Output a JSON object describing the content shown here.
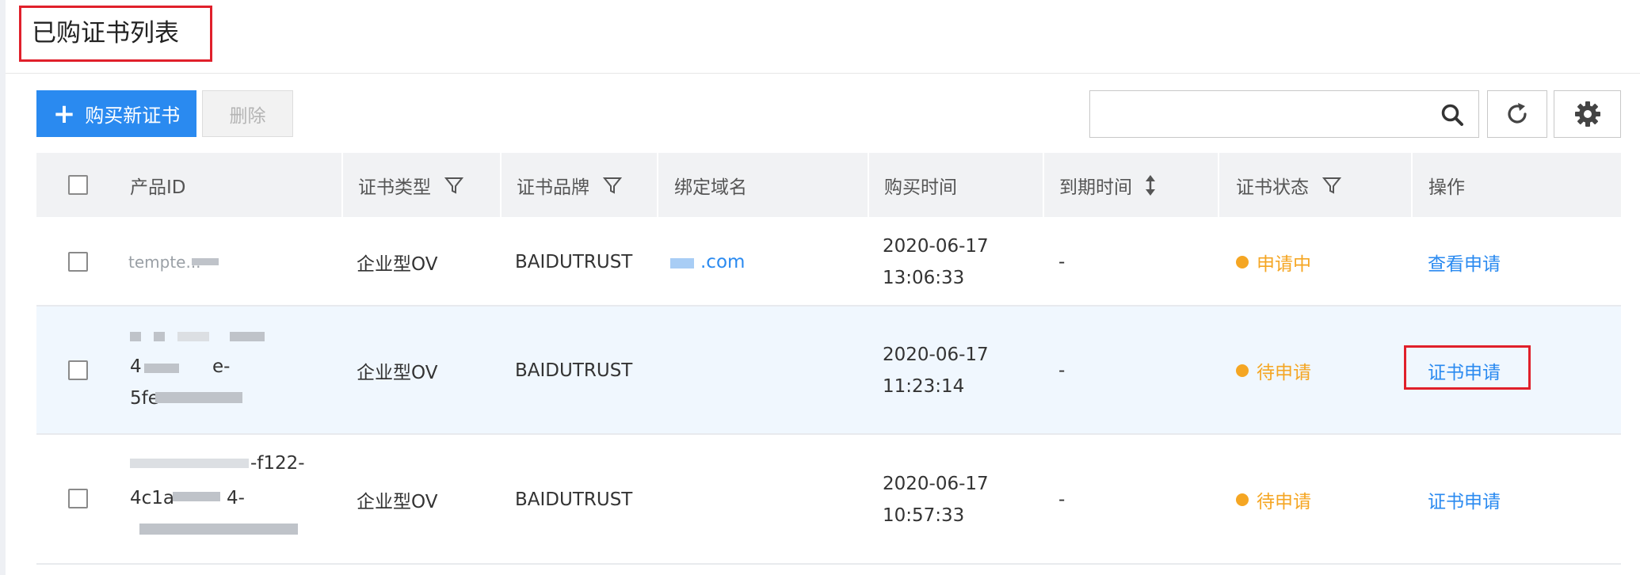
{
  "page": {
    "title": "已购证书列表"
  },
  "toolbar": {
    "buy_button_label": "购买新证书",
    "delete_button_label": "删除",
    "search_placeholder": ""
  },
  "table": {
    "columns": [
      "产品ID",
      "证书类型",
      "证书品牌",
      "绑定域名",
      "购买时间",
      "到期时间",
      "证书状态",
      "操作"
    ],
    "rows": [
      {
        "product_id": "tempte...",
        "cert_type": "企业型OV",
        "brand": "BAIDUTRUST",
        "domain": ".com",
        "purchase_date": "2020-06-17",
        "purchase_time": "13:06:33",
        "expire": "-",
        "status": "申请中",
        "action": "查看申请"
      },
      {
        "product_id_line2": "4",
        "product_id_line2b": "e-",
        "product_id_line3": "5fe",
        "cert_type": "企业型OV",
        "brand": "BAIDUTRUST",
        "domain": "",
        "purchase_date": "2020-06-17",
        "purchase_time": "11:23:14",
        "expire": "-",
        "status": "待申请",
        "action": "证书申请"
      },
      {
        "product_id_line1": "-f122-",
        "product_id_line2": "4c1a",
        "product_id_line2b": "4-",
        "cert_type": "企业型OV",
        "brand": "BAIDUTRUST",
        "domain": "",
        "purchase_date": "2020-06-17",
        "purchase_time": "10:57:33",
        "expire": "-",
        "status": "待申请",
        "action": "证书申请"
      }
    ]
  },
  "colors": {
    "accent": "#2a8af0",
    "warning": "#f5a623",
    "highlight_box": "#e0202b"
  }
}
